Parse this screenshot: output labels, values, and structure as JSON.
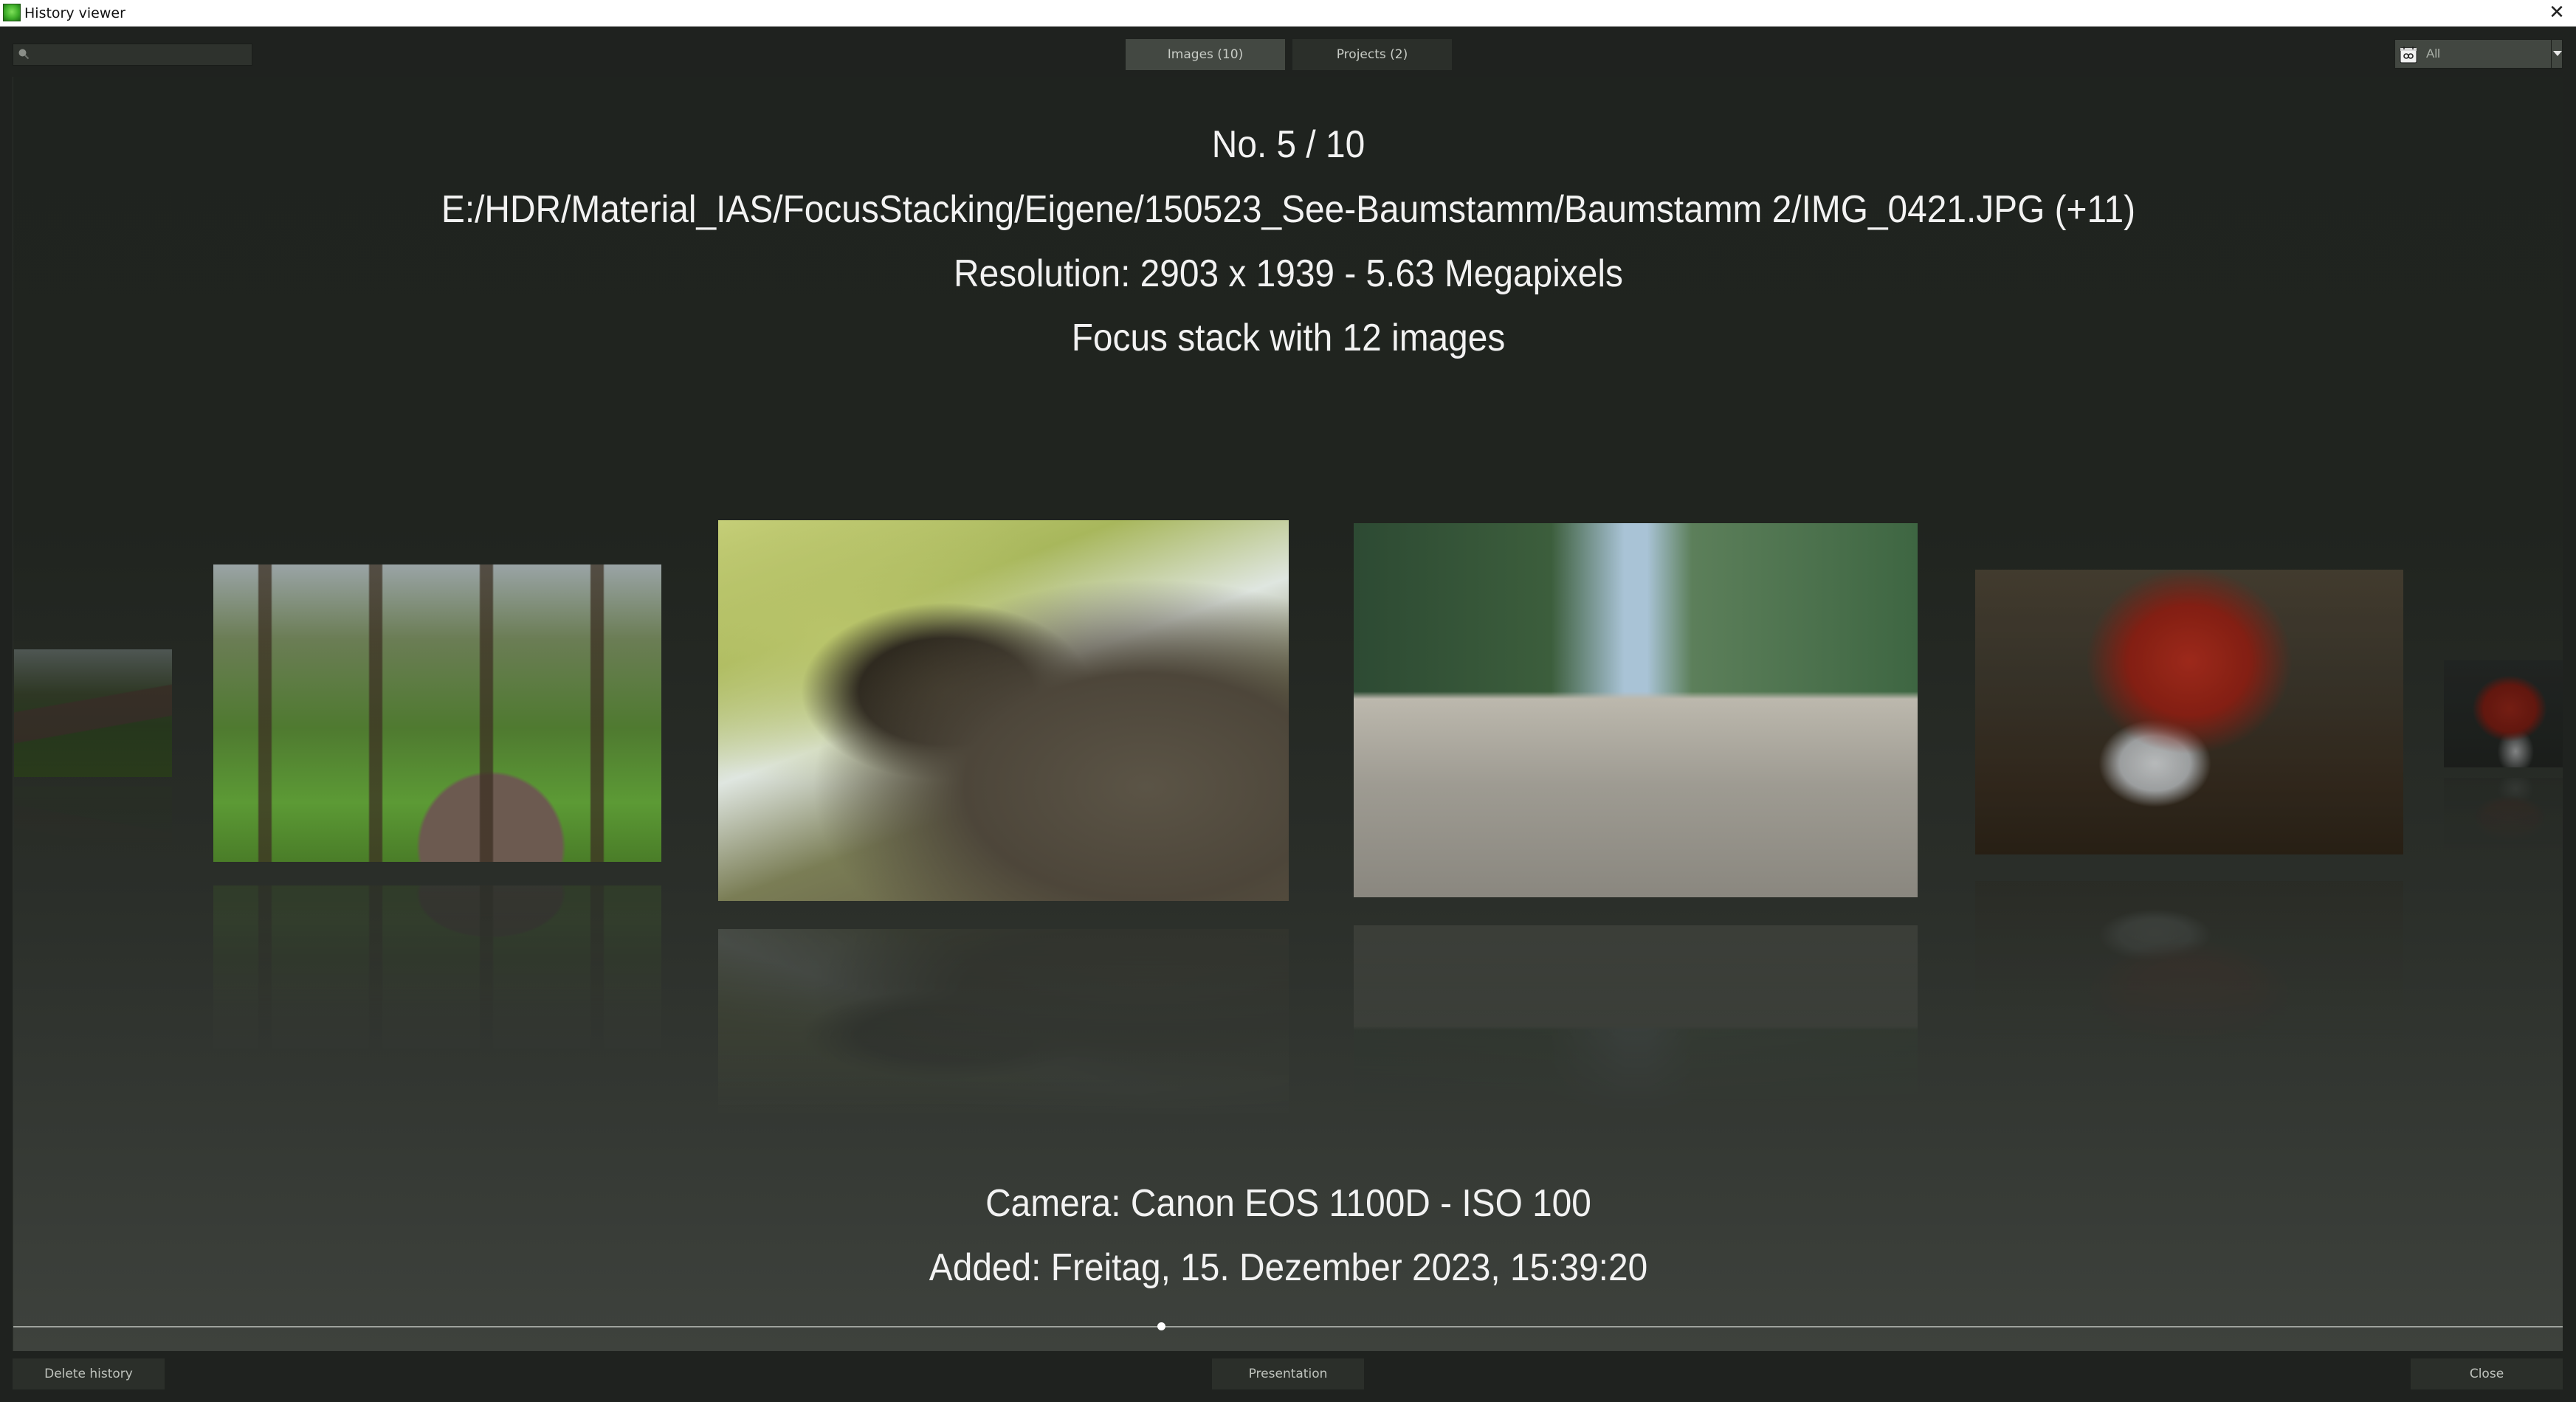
{
  "window": {
    "title": "History viewer",
    "icon": "app-icon",
    "close_glyph": "✕"
  },
  "toolbar": {
    "search": {
      "placeholder": "",
      "value": "",
      "icon": "search-icon"
    },
    "tabs": [
      {
        "label": "Images (10)",
        "active": true
      },
      {
        "label": "Projects (2)",
        "active": false
      }
    ],
    "filter": {
      "icon": "calendar-icon",
      "selected": "All"
    }
  },
  "viewer": {
    "index_line": "No. 5 / 10",
    "path_line": "E:/HDR/Material_IAS/FocusStacking/Eigene/150523_See-Baumstamm/Baumstamm 2/IMG_0421.JPG (+11)",
    "resolution_line": "Resolution: 2903 x 1939  - 5.63 Megapixels",
    "type_line": "Focus stack with 12 images",
    "camera_line": "Camera: Canon EOS 1100D - ISO 100",
    "added_line": "Added: Freitag, 15. Dezember 2023, 15:39:20",
    "thumbnails": [
      {
        "subject": "forest-path",
        "state": "far-left"
      },
      {
        "subject": "forest-path",
        "state": "left"
      },
      {
        "subject": "willow-tree-trunk",
        "state": "current"
      },
      {
        "subject": "field-dirt-track",
        "state": "right"
      },
      {
        "subject": "fly-agaric-mushroom",
        "state": "right"
      },
      {
        "subject": "fly-agaric-mushroom",
        "state": "far-right"
      }
    ],
    "slider": {
      "current": 5,
      "total": 10
    }
  },
  "buttons": {
    "delete_history": "Delete history",
    "presentation": "Presentation",
    "close": "Close"
  }
}
